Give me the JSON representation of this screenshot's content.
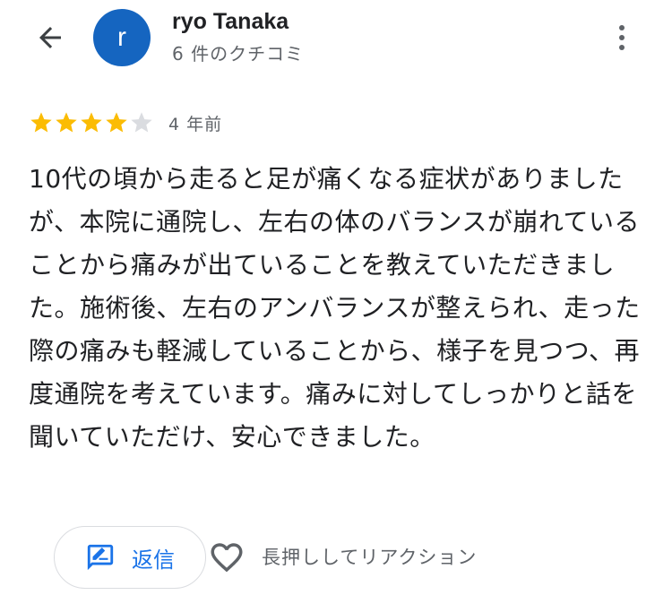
{
  "header": {
    "reviewer_name": "ryo Tanaka",
    "avatar_letter": "r",
    "review_count": "6 件のクチコミ",
    "avatar_color": "#1565c0"
  },
  "review": {
    "rating": 4,
    "max_rating": 5,
    "date": "4 年前",
    "text": "10代の頃から走ると足が痛くなる症状がありましたが、本院に通院し、左右の体のバランスが崩れていることから痛みが出ていることを教えていただきました。施術後、左右のアンバランスが整えられ、走った際の痛みも軽減していることから、様子を見つつ、再度通院を考えています。痛みに対してしっかりと話を聞いていただけ、安心できました。"
  },
  "actions": {
    "reply_label": "返信",
    "reaction_hint": "長押ししてリアクション"
  },
  "colors": {
    "star_filled": "#fbbc04",
    "star_empty": "#dadce0",
    "accent": "#1a73e8"
  },
  "icons": [
    "back-arrow-icon",
    "more-vert-icon",
    "star-icon",
    "reply-icon",
    "heart-icon"
  ]
}
